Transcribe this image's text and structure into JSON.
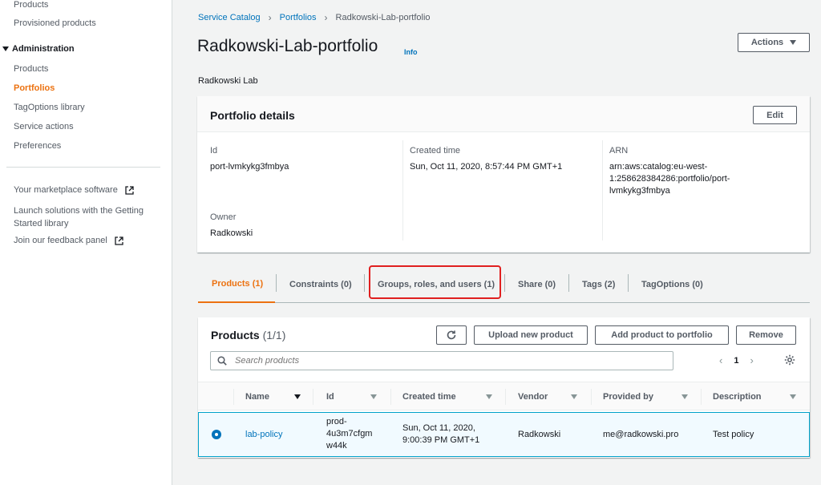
{
  "sidebar": {
    "products": "Products",
    "provisioned_products": "Provisioned products",
    "admin_section": "Administration",
    "admin_items": [
      "Products",
      "Portfolios",
      "TagOptions library",
      "Service actions",
      "Preferences"
    ],
    "marketplace": "Your marketplace software",
    "getting_started_line1": "Launch solutions with the Getting",
    "getting_started_line2": "Started library",
    "feedback": "Join our feedback panel"
  },
  "breadcrumb": [
    "Service Catalog",
    "Portfolios",
    "Radkowski-Lab-portfolio"
  ],
  "header": {
    "title": "Radkowski-Lab-portfolio",
    "info": "Info",
    "subtitle": "Radkowski Lab",
    "actions": "Actions"
  },
  "details": {
    "title": "Portfolio details",
    "edit": "Edit",
    "id_label": "Id",
    "id_value": "port-lvmkykg3fmbya",
    "created_label": "Created time",
    "created_value": "Sun, Oct 11, 2020, 8:57:44 PM GMT+1",
    "arn_label": "ARN",
    "arn_line1": "arn:aws:catalog:eu-west-",
    "arn_line2": "1:258628384286:portfolio/port-",
    "arn_line3": "lvmkykg3fmbya",
    "owner_label": "Owner",
    "owner_value": "Radkowski"
  },
  "tabs": [
    "Products (1)",
    "Constraints (0)",
    "Groups, roles, and users (1)",
    "Share (0)",
    "Tags (2)",
    "TagOptions (0)"
  ],
  "products": {
    "title": "Products",
    "count": "(1/1)",
    "upload": "Upload new product",
    "add": "Add product to portfolio",
    "remove": "Remove",
    "search_placeholder": "Search products",
    "page": "1",
    "columns": [
      "Name",
      "Id",
      "Created time",
      "Vendor",
      "Provided by",
      "Description"
    ],
    "row": {
      "name": "lab-policy",
      "id_line1": "prod-",
      "id_line2": "4u3m7cfgm",
      "id_line3": "w44k",
      "created_line1": "Sun, Oct 11, 2020,",
      "created_line2": "9:00:39 PM GMT+1",
      "vendor": "Radkowski",
      "provided_by": "me@radkowski.pro",
      "description": "Test policy"
    }
  },
  "icons": {
    "external_link": "external-link-icon",
    "refresh": "refresh-icon",
    "search": "search-icon",
    "gear": "gear-icon"
  },
  "colors": {
    "accent": "#ec7211",
    "link": "#0073bb",
    "selected_row_border": "#00a1c9",
    "highlight": "#e02020"
  }
}
